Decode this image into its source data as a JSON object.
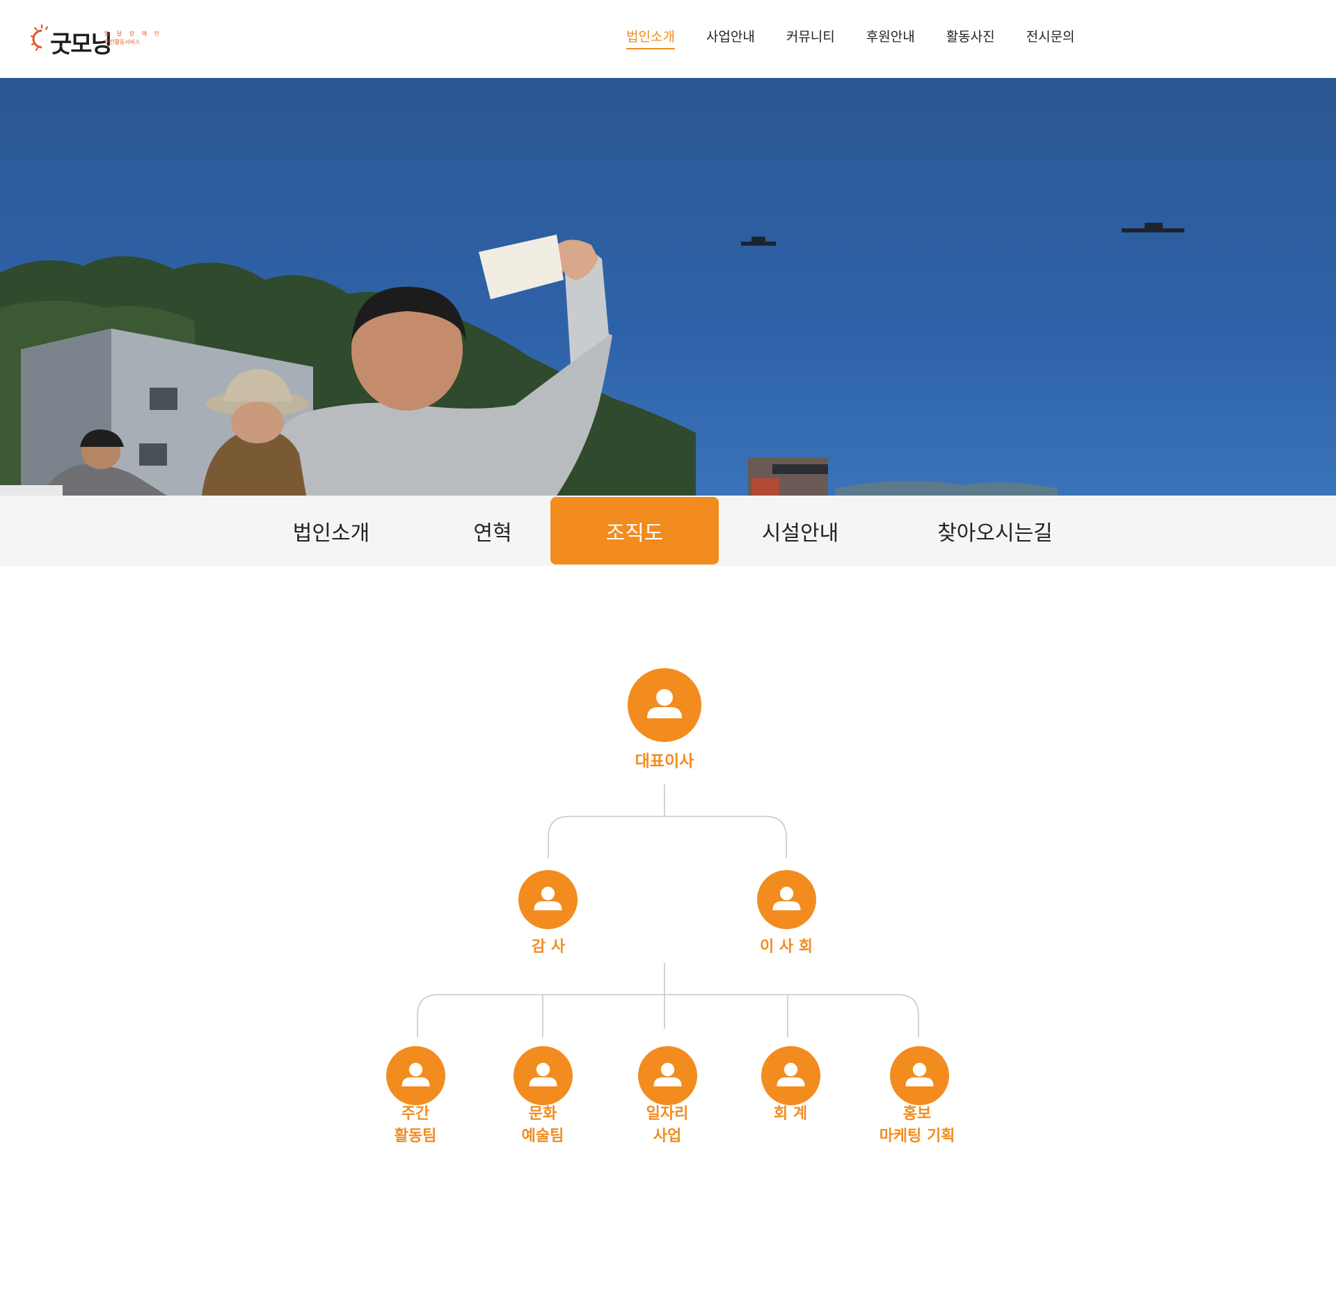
{
  "logo": {
    "name": "굿모닝",
    "sub_line1": "발 달 장 애 인",
    "sub_line2": "주간활동서비스"
  },
  "gnb": {
    "items": [
      {
        "label": "법인소개",
        "active": true
      },
      {
        "label": "사업안내"
      },
      {
        "label": "커뮤니티"
      },
      {
        "label": "후원안내"
      },
      {
        "label": "활동사진"
      },
      {
        "label": "전시문의"
      }
    ]
  },
  "tabs": {
    "items": [
      {
        "label": "법인소개"
      },
      {
        "label": "연혁"
      },
      {
        "label": "조직도",
        "active": true
      },
      {
        "label": "시설안내"
      },
      {
        "label": "찾아오시는길"
      }
    ]
  },
  "org": {
    "ceo": "대표이사",
    "auditor": "감  사",
    "board": "이 사 회",
    "teams": [
      "주간\n활동팀",
      "문화\n예술팀",
      "일자리\n사업",
      "회  계",
      "홍보\n마케팅 기획"
    ]
  },
  "colors": {
    "accent": "#f28c1f",
    "tab_bg": "#f5f5f5",
    "line": "#c8c8c8"
  },
  "icons": {
    "node": "person-icon",
    "logo": "sun-icon"
  }
}
